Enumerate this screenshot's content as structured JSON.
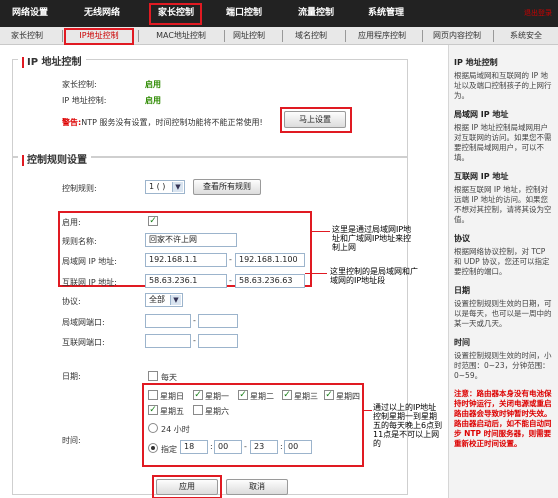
{
  "topnav": {
    "items": [
      "网络设置",
      "无线网络",
      "家长控制",
      "端口控制",
      "流量控制",
      "系统管理"
    ],
    "login": "退出登录"
  },
  "subnav": {
    "items": [
      "家长控制",
      "IP地址控制",
      "MAC地址控制",
      "网址控制",
      "域名控制",
      "应用程序控制",
      "网页内容控制",
      "系统安全"
    ]
  },
  "ip_panel": {
    "title": "IP 地址控制",
    "parent_label": "家长控制:",
    "parent_value": "启用",
    "ipctrl_label": "IP 地址控制:",
    "ipctrl_value": "启用",
    "warn_prefix": "警告:",
    "warn_text": "NTP 服务没有设置，时间控制功能将不能正常使用!",
    "setup_button": "马上设置"
  },
  "rule_panel": {
    "title": "控制规则设置",
    "rule_label": "控制规则:",
    "rule_value": "1 ( )",
    "view_all": "查看所有规则",
    "enable_label": "启用:",
    "name_label": "规则名称:",
    "name_value": "回家不许上网",
    "lan_label": "局域网 IP 地址:",
    "lan_from": "192.168.1.1",
    "lan_to": "192.168.1.100",
    "wan_label": "互联网 IP 地址:",
    "wan_from": "58.63.236.1",
    "wan_to": "58.63.236.63",
    "proto_label": "协议:",
    "proto_value": "全部",
    "lanport_label": "局域网端口:",
    "wanport_label": "互联网端口:",
    "date_label": "日期:",
    "everyday": "每天",
    "days": [
      "星期日",
      "星期一",
      "星期二",
      "星期三",
      "星期四",
      "星期五",
      "星期六"
    ],
    "time_label": "时间:",
    "h24": "24 小时",
    "specify": "指定",
    "t1": "18",
    "t2": "00",
    "t3": "23",
    "t4": "00",
    "apply": "应用",
    "cancel": "取消"
  },
  "notes": {
    "n1": "这里是通过局域网IP地址和广域网IP地址来控制上网",
    "n2": "这里控制的是局域网和广域网的IP地址段",
    "n3": "通过以上的IP地址控制星期一到星期五的每天晚上6点到11点是不可以上网的"
  },
  "side": [
    {
      "h": "IP 地址控制",
      "p": "根据局域网和互联网的 IP 地址以及端口控制孩子的上网行为。"
    },
    {
      "h": "局域网 IP 地址",
      "p": "根据 IP 地址控制局域网用户对互联网的访问。如果您不需要控制局域网用户，可以不填。"
    },
    {
      "h": "互联网 IP 地址",
      "p": "根据互联网 IP 地址，控制对远端 IP 地址的访问。如果您不想对其控制，请将其设为空值。"
    },
    {
      "h": "协议",
      "p": "根据网络协议控制，对 TCP 和 UDP 协议，您还可以指定要控制的端口。"
    },
    {
      "h": "日期",
      "p": "设置控制规则生效的日期，可以是每天，也可以是一周中的某一天或几天。"
    },
    {
      "h": "时间",
      "p": "设置控制规则生效的时间，小时范围：0~23，分钟范围：0~59。"
    }
  ],
  "side_warn": "注意：路由器本身没有电池保持时钟运行，关闭电源或重启路由器会导致时钟暂时失效。路由器启动后，如不能自动同步 NTP 时间服务器，则需要重新校正时间设置。"
}
